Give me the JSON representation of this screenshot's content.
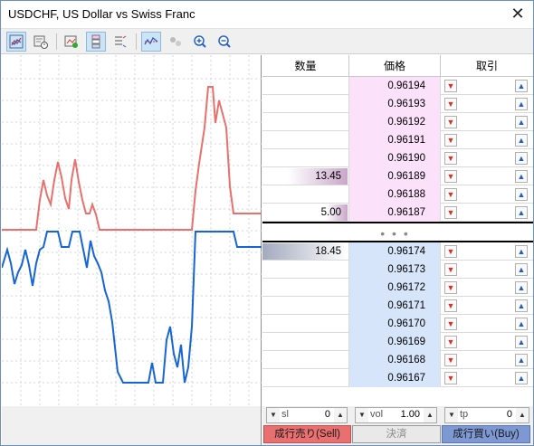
{
  "window": {
    "title": "USDCHF, US Dollar vs Swiss Franc"
  },
  "toolbar": {
    "buttons": [
      {
        "name": "chart-icon",
        "active": true
      },
      {
        "name": "tick-chart-icon",
        "active": false
      },
      {
        "name": "signal-icon",
        "active": false
      },
      {
        "name": "depth-icon",
        "active": true
      },
      {
        "name": "list-icon",
        "active": false
      },
      {
        "name": "trade-levels-icon",
        "active": true
      },
      {
        "name": "dots-icon",
        "active": false
      },
      {
        "name": "zoom-in-icon",
        "active": false
      },
      {
        "name": "zoom-out-icon",
        "active": false
      }
    ]
  },
  "depth": {
    "headers": {
      "volume": "数量",
      "price": "価格",
      "trade": "取引"
    },
    "asks": [
      {
        "volume": "",
        "price": "0.96194"
      },
      {
        "volume": "",
        "price": "0.96193"
      },
      {
        "volume": "",
        "price": "0.96192"
      },
      {
        "volume": "",
        "price": "0.96191"
      },
      {
        "volume": "",
        "price": "0.96190"
      },
      {
        "volume": "13.45",
        "price": "0.96189"
      },
      {
        "volume": "",
        "price": "0.96188"
      },
      {
        "volume": "5.00",
        "price": "0.96187"
      }
    ],
    "bids": [
      {
        "volume": "18.45",
        "price": "0.96174"
      },
      {
        "volume": "",
        "price": "0.96173"
      },
      {
        "volume": "",
        "price": "0.96172"
      },
      {
        "volume": "",
        "price": "0.96171"
      },
      {
        "volume": "",
        "price": "0.96170"
      },
      {
        "volume": "",
        "price": "0.96169"
      },
      {
        "volume": "",
        "price": "0.96168"
      },
      {
        "volume": "",
        "price": "0.96167"
      }
    ],
    "spread_dots": "• • •"
  },
  "controls": {
    "sl": {
      "label": "sl",
      "value": "0"
    },
    "vol": {
      "label": "vol",
      "value": "1.00"
    },
    "tp": {
      "label": "tp",
      "value": "0"
    },
    "sell_label": "成行売り(Sell)",
    "close_label": "決済",
    "buy_label": "成行買い(Buy)"
  },
  "colors": {
    "ask_line": "#e8706d",
    "bid_line": "#1565d6",
    "ask_bg": "#fbe1fa",
    "bid_bg": "#d6e5f9"
  }
}
